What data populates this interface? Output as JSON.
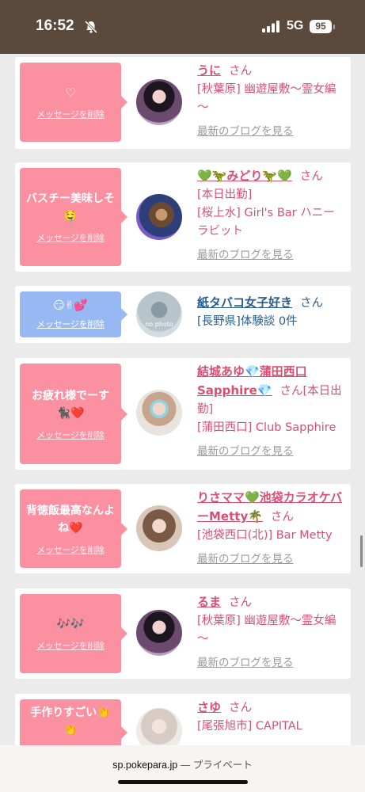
{
  "status": {
    "time": "16:52",
    "network": "5G",
    "battery": "95"
  },
  "delete_label": "メッセージを削除",
  "blog_label": "最新のブログを見る",
  "san": "さん",
  "cards": [
    {
      "message": "♡",
      "name": "うに",
      "lines": [
        "[秋葉原] 幽遊屋敷～霊女編～"
      ],
      "blog": true
    },
    {
      "message": "バスチー美味しそ🤤",
      "name": "💚🦖みどり🦖💚",
      "lines": [
        "[本日出勤]",
        "[桜上水] Girl's Bar ハニーラビット"
      ],
      "blog": true
    },
    {
      "message": "😏✌💕",
      "name": "紙タバコ女子好き",
      "lines": [
        "[長野県]体験談 0件"
      ],
      "blog": false,
      "avatar_text": "no photo"
    },
    {
      "message": "お疲れ様でーす🐈‍⬛❤️",
      "name": "結城あゆ💎蒲田西口Sapphire💎",
      "name_tail": "[本日出勤]",
      "lines": [
        "[蒲田西口] Club Sapphire"
      ],
      "blog": true
    },
    {
      "message": "背徳飯最高なんよね❤️",
      "name": "りさママ💚池袋カラオケバーMetty🌴",
      "lines": [
        "[池袋西口(北)] Bar Metty"
      ],
      "blog": true
    },
    {
      "message": "🎶🎶",
      "name": "るま",
      "lines": [
        "[秋葉原] 幽遊屋敷～霊女編～"
      ],
      "blog": true
    },
    {
      "message": "手作りすごい👏👏",
      "name": "さゆ",
      "lines": [
        "[尾張旭市] CAPITAL"
      ],
      "blog": false
    }
  ],
  "browser": {
    "domain": "sp.pokepara.jp",
    "separator": " — ",
    "mode": "プライベート"
  }
}
